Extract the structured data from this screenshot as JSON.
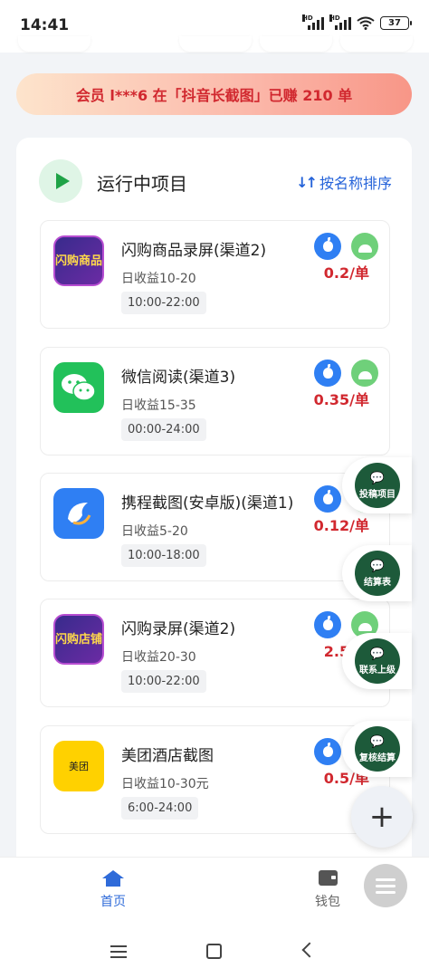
{
  "status_bar": {
    "time": "14:41",
    "signal1": "HD",
    "signal2": "HD",
    "battery": "37"
  },
  "banner": {
    "text": "会员 l***6 在「抖音长截图」已赚 210 单"
  },
  "section": {
    "title": "运行中项目",
    "sort_label": "按名称排序"
  },
  "projects": [
    {
      "name": "闪购商品录屏(渠道2)",
      "income": "日收益10-20",
      "hours": "10:00-22:00",
      "price": "0.2/单",
      "icon": "shangou-goods-icon",
      "icon_text": "闪购商品"
    },
    {
      "name": "微信阅读(渠道3)",
      "income": "日收益15-35",
      "hours": "00:00-24:00",
      "price": "0.35/单",
      "icon": "wechat-icon",
      "icon_text": ""
    },
    {
      "name": "携程截图(安卓版)(渠道1)",
      "income": "日收益5-20",
      "hours": "10:00-18:00",
      "price": "0.12/单",
      "icon": "ctrip-dolphin-icon",
      "icon_text": ""
    },
    {
      "name": "闪购录屏(渠道2)",
      "income": "日收益20-30",
      "hours": "10:00-22:00",
      "price": "2.5/单",
      "icon": "shangou-store-icon",
      "icon_text": "闪购店铺"
    },
    {
      "name": "美团酒店截图",
      "income": "日收益10-30元",
      "hours": "6:00-24:00",
      "price": "0.5/单",
      "icon": "meituan-icon",
      "icon_text": "美团"
    }
  ],
  "float_actions": [
    {
      "label": "投稿项目"
    },
    {
      "label": "结算表"
    },
    {
      "label": "联系上级"
    },
    {
      "label": "复核结算"
    }
  ],
  "fab": {
    "symbol": "+"
  },
  "bottom_nav": {
    "home": "首页",
    "wallet": "钱包"
  },
  "colors": {
    "accent": "#2f6bd9",
    "price": "#d1282f",
    "ios": "#2f7ff3",
    "android": "#6fd07a",
    "badge": "#1d5a3a"
  }
}
